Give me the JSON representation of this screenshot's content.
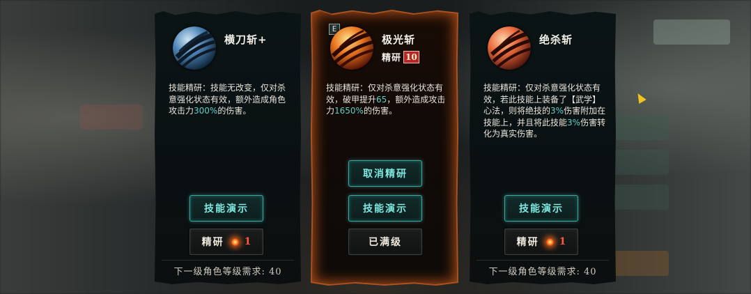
{
  "cards": [
    {
      "name": "横刀斩+",
      "icon": "blue-slash-skill-icon",
      "desc_parts": [
        "技能精研：技能无改变，仅对杀意强化状态有效，额外造成角色攻击力",
        "300%",
        "的伤害。"
      ],
      "demo_label": "技能演示",
      "refine_button": {
        "label": "精研",
        "cost": "1"
      },
      "footer": "下一级角色等级需求: 40"
    },
    {
      "name": "极光斩",
      "icon": "orange-fire-slash-skill-icon",
      "badge": "E",
      "refine_label": "精研",
      "refine_level": "10",
      "desc_parts": [
        "技能精研：仅对杀意强化状态有效，破甲提升",
        "65",
        "，额外造成攻击力",
        "1650%",
        "的伤害。"
      ],
      "cancel_label": "取消精研",
      "demo_label": "技能演示",
      "max_label": "已满级"
    },
    {
      "name": "绝杀斩",
      "icon": "red-slash-skill-icon",
      "desc_parts": [
        "技能精研：仅对杀意强化状态有效，若此技能上装备了【武学】心法，则将绝技的",
        "3%",
        "伤害附加在技能上，并且将此技能",
        "3%",
        "伤害转化为真实伤害。"
      ],
      "demo_label": "技能演示",
      "refine_button": {
        "label": "精研",
        "cost": "1"
      },
      "footer": "下一级角色等级需求: 40"
    }
  ],
  "colors": {
    "highlight": "#5fd0ca",
    "selected_glow": "#c25a22",
    "button_teal": "#7fe8df"
  }
}
